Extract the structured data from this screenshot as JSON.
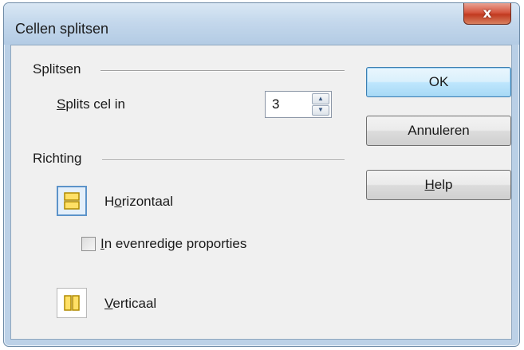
{
  "window": {
    "title": "Cellen splitsen",
    "close_glyph": "x"
  },
  "split_section": {
    "title": "Splitsen",
    "split_label_prefix": "S",
    "split_label_rest": "plits cel in",
    "split_value": "3"
  },
  "direction_section": {
    "title": "Richting",
    "horizontal_pre": "H",
    "horizontal_u": "o",
    "horizontal_post": "rizontaal",
    "proportional_u": "I",
    "proportional_post": "n evenredige proporties",
    "vertical_u": "V",
    "vertical_post": "erticaal",
    "selected": "horizontal"
  },
  "buttons": {
    "ok": "OK",
    "cancel": "Annuleren",
    "help_u": "H",
    "help_post": "elp"
  },
  "colors": {
    "accent": "#3c7fb1",
    "icon_fill": "#ffe066",
    "icon_stroke": "#b08a00"
  }
}
